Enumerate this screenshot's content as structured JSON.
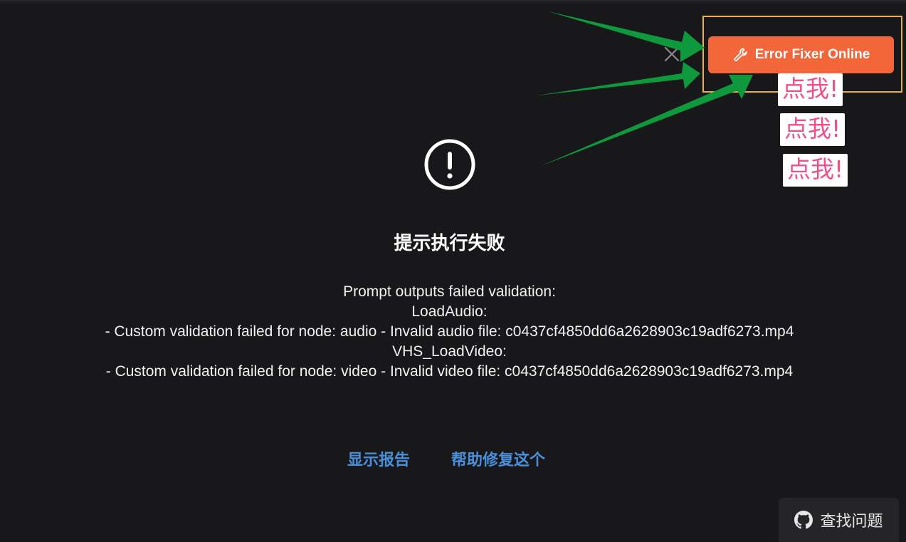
{
  "error": {
    "title": "提示执行失败",
    "message_lines": [
      "Prompt outputs failed validation:",
      "LoadAudio:",
      "- Custom validation failed for node: audio - Invalid audio file: c0437cf4850dd6a2628903c19adf6273.mp4",
      "VHS_LoadVideo:",
      "- Custom validation failed for node: video - Invalid video file: c0437cf4850dd6a2628903c19adf6273.mp4"
    ]
  },
  "actions": {
    "show_report": "显示报告",
    "help_fix": "帮助修复这个"
  },
  "fixer": {
    "label": "Error Fixer Online",
    "icon": "wrench-icon"
  },
  "annotations": {
    "click_me": [
      "点我!",
      "点我!",
      "点我!"
    ]
  },
  "find_issues": {
    "label": "查找问题",
    "icon": "github-icon"
  },
  "colors": {
    "background": "#18181a",
    "fixer_button": "#f3663a",
    "highlight_border": "#e8b44a",
    "arrow_green": "#0e9a3c",
    "link_blue": "#4a8fd9",
    "click_me_pink": "#f0508a"
  }
}
